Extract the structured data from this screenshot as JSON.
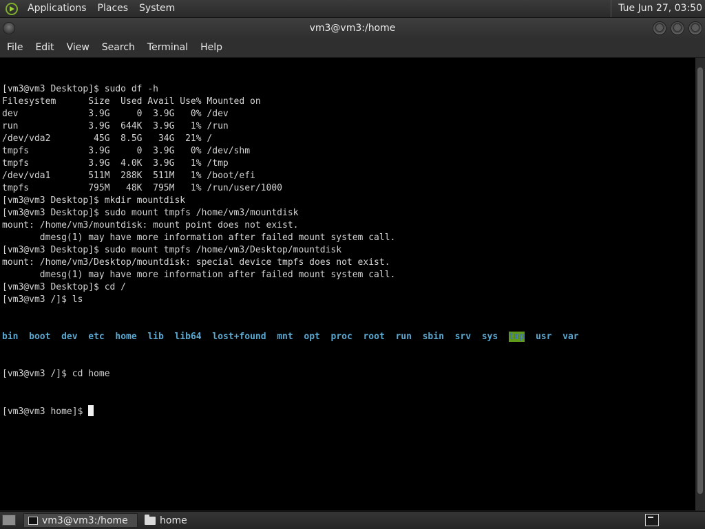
{
  "top_panel": {
    "menus": [
      "Applications",
      "Places",
      "System"
    ],
    "clock": "Tue Jun 27, 03:50"
  },
  "window": {
    "title": "vm3@vm3:/home"
  },
  "menubar": {
    "items": [
      "File",
      "Edit",
      "View",
      "Search",
      "Terminal",
      "Help"
    ]
  },
  "terminal": {
    "lines": [
      "[vm3@vm3 Desktop]$ sudo df -h",
      "Filesystem      Size  Used Avail Use% Mounted on",
      "dev             3.9G     0  3.9G   0% /dev",
      "run             3.9G  644K  3.9G   1% /run",
      "/dev/vda2        45G  8.5G   34G  21% /",
      "tmpfs           3.9G     0  3.9G   0% /dev/shm",
      "tmpfs           3.9G  4.0K  3.9G   1% /tmp",
      "/dev/vda1       511M  288K  511M   1% /boot/efi",
      "tmpfs           795M   48K  795M   1% /run/user/1000",
      "[vm3@vm3 Desktop]$ mkdir mountdisk",
      "[vm3@vm3 Desktop]$ sudo mount tmpfs /home/vm3/mountdisk",
      "mount: /home/vm3/mountdisk: mount point does not exist.",
      "       dmesg(1) may have more information after failed mount system call.",
      "[vm3@vm3 Desktop]$ sudo mount tmpfs /home/vm3/Desktop/mountdisk",
      "mount: /home/vm3/Desktop/mountdisk: special device tmpfs does not exist.",
      "       dmesg(1) may have more information after failed mount system call.",
      "[vm3@vm3 Desktop]$ cd /",
      "[vm3@vm3 /]$ ls"
    ],
    "ls_entries": [
      {
        "name": "bin",
        "style": "dir"
      },
      {
        "name": "boot",
        "style": "dir"
      },
      {
        "name": "dev",
        "style": "dir"
      },
      {
        "name": "etc",
        "style": "dir"
      },
      {
        "name": "home",
        "style": "dir"
      },
      {
        "name": "lib",
        "style": "dir"
      },
      {
        "name": "lib64",
        "style": "dir"
      },
      {
        "name": "lost+found",
        "style": "dir"
      },
      {
        "name": "mnt",
        "style": "dir"
      },
      {
        "name": "opt",
        "style": "dir"
      },
      {
        "name": "proc",
        "style": "dir"
      },
      {
        "name": "root",
        "style": "dir"
      },
      {
        "name": "run",
        "style": "dir"
      },
      {
        "name": "sbin",
        "style": "dir"
      },
      {
        "name": "srv",
        "style": "dir"
      },
      {
        "name": "sys",
        "style": "dir"
      },
      {
        "name": "tmp",
        "style": "sticky"
      },
      {
        "name": "usr",
        "style": "dir"
      },
      {
        "name": "var",
        "style": "dir"
      }
    ],
    "lines_after": [
      "[vm3@vm3 /]$ cd home"
    ],
    "prompt": "[vm3@vm3 home]$ "
  },
  "taskbar": {
    "tasks": [
      {
        "label": "vm3@vm3:/home",
        "icon": "terminal-icon",
        "active": true
      },
      {
        "label": "home",
        "icon": "folder-icon",
        "active": false
      }
    ]
  },
  "colors": {
    "terminal_bg": "#000000",
    "terminal_fg": "#d4d4d4",
    "directory": "#5aa8d2",
    "sticky_dir_bg": "#5f9a1a"
  }
}
